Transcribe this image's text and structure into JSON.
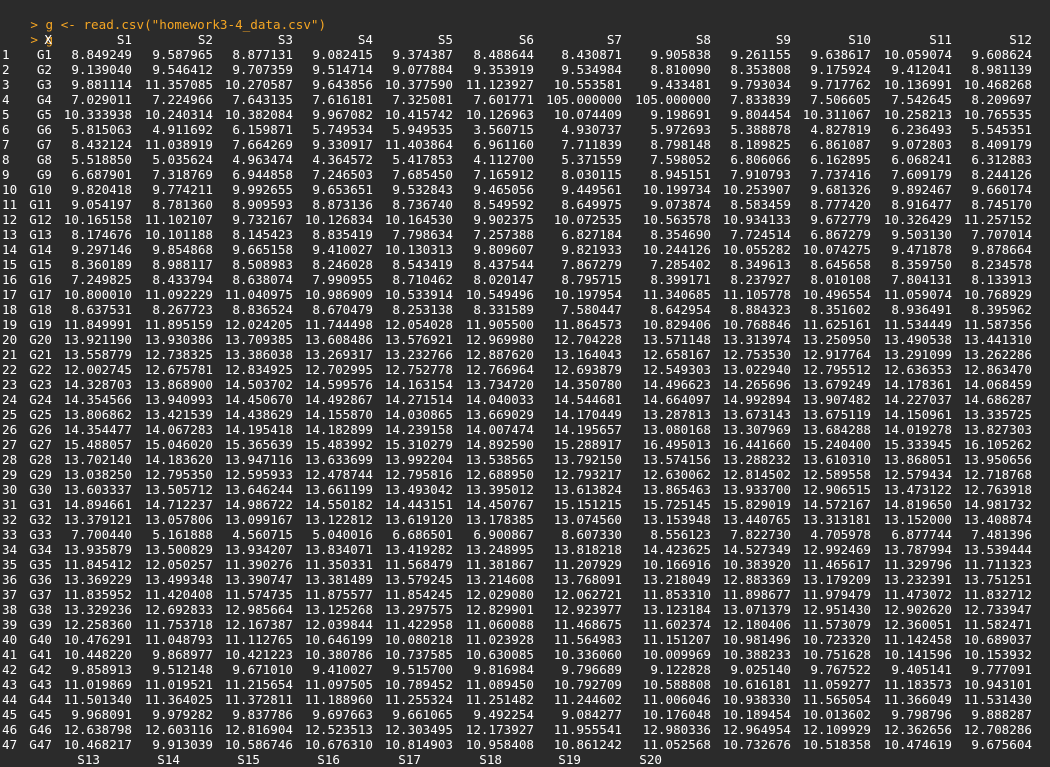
{
  "console": {
    "prompt": ">",
    "command": "g <- read.csv(\"homework3-4_data.csv\")",
    "command2": "g"
  },
  "table": {
    "columns": [
      "X",
      "S1",
      "S2",
      "S3",
      "S4",
      "S5",
      "S6",
      "S7",
      "S8",
      "S9",
      "S10",
      "S11",
      "S12"
    ],
    "rows": [
      [
        "1",
        "G1",
        "8.849249",
        "9.587965",
        "8.877131",
        "9.082415",
        "9.374387",
        "8.488644",
        "8.430871",
        "9.905838",
        "9.261155",
        "9.638617",
        "10.059074",
        "9.608624"
      ],
      [
        "2",
        "G2",
        "9.139040",
        "9.546412",
        "9.707359",
        "9.514714",
        "9.077884",
        "9.353919",
        "9.534984",
        "8.810090",
        "8.353808",
        "9.175924",
        "9.412041",
        "8.981139"
      ],
      [
        "3",
        "G3",
        "9.881114",
        "11.357085",
        "10.270587",
        "9.643856",
        "10.377590",
        "11.123927",
        "10.553581",
        "9.433481",
        "9.793034",
        "9.717762",
        "10.136991",
        "10.468268"
      ],
      [
        "4",
        "G4",
        "7.029011",
        "7.224966",
        "7.643135",
        "7.616181",
        "7.325081",
        "7.601771",
        "105.000000",
        "105.000000",
        "7.833839",
        "7.506605",
        "7.542645",
        "8.209697"
      ],
      [
        "5",
        "G5",
        "10.333938",
        "10.240314",
        "10.382084",
        "9.967082",
        "10.415742",
        "10.126963",
        "10.074409",
        "9.198691",
        "9.804454",
        "10.311067",
        "10.258213",
        "10.765535"
      ],
      [
        "6",
        "G6",
        "5.815063",
        "4.911692",
        "6.159871",
        "5.749534",
        "5.949535",
        "3.560715",
        "4.930737",
        "5.972693",
        "5.388878",
        "4.827819",
        "6.236493",
        "5.545351"
      ],
      [
        "7",
        "G7",
        "8.432124",
        "11.038919",
        "7.664269",
        "9.330917",
        "11.403864",
        "6.961160",
        "7.711839",
        "8.798148",
        "8.189825",
        "6.861087",
        "9.072803",
        "8.409179"
      ],
      [
        "8",
        "G8",
        "5.518850",
        "5.035624",
        "4.963474",
        "4.364572",
        "5.417853",
        "4.112700",
        "5.371559",
        "7.598052",
        "6.806066",
        "6.162895",
        "6.068241",
        "6.312883"
      ],
      [
        "9",
        "G9",
        "6.687901",
        "7.318769",
        "6.944858",
        "7.246503",
        "7.685450",
        "7.165912",
        "8.030115",
        "8.945151",
        "7.910793",
        "7.737416",
        "7.609179",
        "8.244126"
      ],
      [
        "10",
        "G10",
        "9.820418",
        "9.774211",
        "9.992655",
        "9.653651",
        "9.532843",
        "9.465056",
        "9.449561",
        "10.199734",
        "10.253907",
        "9.681326",
        "9.892467",
        "9.660174"
      ],
      [
        "11",
        "G11",
        "9.054197",
        "8.781360",
        "8.909593",
        "8.873136",
        "8.736740",
        "8.549592",
        "8.649975",
        "9.073874",
        "8.583459",
        "8.777420",
        "8.916477",
        "8.745170"
      ],
      [
        "12",
        "G12",
        "10.165158",
        "11.102107",
        "9.732167",
        "10.126834",
        "10.164530",
        "9.902375",
        "10.072535",
        "10.563578",
        "10.934133",
        "9.672779",
        "10.326429",
        "11.257152"
      ],
      [
        "13",
        "G13",
        "8.174676",
        "10.101188",
        "8.145423",
        "8.835419",
        "7.798634",
        "7.257388",
        "6.827184",
        "8.354690",
        "7.724514",
        "6.867279",
        "9.503130",
        "7.707014"
      ],
      [
        "14",
        "G14",
        "9.297146",
        "9.854868",
        "9.665158",
        "9.410027",
        "10.130313",
        "9.809607",
        "9.821933",
        "10.244126",
        "10.055282",
        "10.074275",
        "9.471878",
        "9.878664"
      ],
      [
        "15",
        "G15",
        "8.360189",
        "8.988117",
        "8.508983",
        "8.246028",
        "8.543419",
        "8.437544",
        "7.867279",
        "7.285402",
        "8.349613",
        "8.645658",
        "8.359750",
        "8.234578"
      ],
      [
        "16",
        "G16",
        "7.249825",
        "8.433794",
        "8.638074",
        "7.990955",
        "8.710462",
        "8.020147",
        "8.795715",
        "8.399171",
        "8.237927",
        "8.010108",
        "7.804131",
        "8.133913"
      ],
      [
        "17",
        "G17",
        "10.800010",
        "11.092229",
        "11.040975",
        "10.986909",
        "10.533914",
        "10.549496",
        "10.197954",
        "11.340685",
        "11.105778",
        "10.496554",
        "11.059074",
        "10.768929"
      ],
      [
        "18",
        "G18",
        "8.637531",
        "8.267723",
        "8.836524",
        "8.670479",
        "8.253138",
        "8.331589",
        "7.580447",
        "8.642954",
        "8.884323",
        "8.351602",
        "8.936491",
        "8.395962"
      ],
      [
        "19",
        "G19",
        "11.849991",
        "11.895159",
        "12.024205",
        "11.744498",
        "12.054028",
        "11.905500",
        "11.864573",
        "10.829406",
        "10.768846",
        "11.625161",
        "11.534449",
        "11.587356"
      ],
      [
        "20",
        "G20",
        "13.921190",
        "13.930386",
        "13.709385",
        "13.608486",
        "13.576921",
        "12.969980",
        "12.704228",
        "13.571148",
        "13.313974",
        "13.250950",
        "13.490538",
        "13.441310"
      ],
      [
        "21",
        "G21",
        "13.558779",
        "12.738325",
        "13.386038",
        "13.269317",
        "13.232766",
        "12.887620",
        "13.164043",
        "12.658167",
        "12.753530",
        "12.917764",
        "13.291099",
        "13.262286"
      ],
      [
        "22",
        "G22",
        "12.002745",
        "12.675781",
        "12.834925",
        "12.702995",
        "12.752778",
        "12.766964",
        "12.693879",
        "12.549303",
        "13.022940",
        "12.795512",
        "12.636353",
        "12.863470"
      ],
      [
        "23",
        "G23",
        "14.328703",
        "13.868900",
        "14.503702",
        "14.599576",
        "14.163154",
        "13.734720",
        "14.350780",
        "14.496623",
        "14.265696",
        "13.679249",
        "14.178361",
        "14.068459"
      ],
      [
        "24",
        "G24",
        "14.354566",
        "13.940993",
        "14.450670",
        "14.492867",
        "14.271514",
        "14.040033",
        "14.544681",
        "14.664097",
        "14.992894",
        "13.907482",
        "14.227037",
        "14.686287"
      ],
      [
        "25",
        "G25",
        "13.806862",
        "13.421539",
        "14.438629",
        "14.155870",
        "14.030865",
        "13.669029",
        "14.170449",
        "13.287813",
        "13.673143",
        "13.675119",
        "14.150961",
        "13.335725"
      ],
      [
        "26",
        "G26",
        "14.354477",
        "14.067283",
        "14.195418",
        "14.182899",
        "14.239158",
        "14.007474",
        "14.195657",
        "13.080168",
        "13.307969",
        "13.684288",
        "14.019278",
        "13.827303"
      ],
      [
        "27",
        "G27",
        "15.488057",
        "15.046020",
        "15.365639",
        "15.483992",
        "15.310279",
        "14.892590",
        "15.288917",
        "16.495013",
        "16.441660",
        "15.240400",
        "15.333945",
        "16.105262"
      ],
      [
        "28",
        "G28",
        "13.702140",
        "14.183620",
        "13.947116",
        "13.633699",
        "13.992204",
        "13.538565",
        "13.792150",
        "13.574156",
        "13.288232",
        "13.610310",
        "13.868051",
        "13.950656"
      ],
      [
        "29",
        "G29",
        "13.038250",
        "12.795350",
        "12.595933",
        "12.478744",
        "12.795816",
        "12.688950",
        "12.793217",
        "12.630062",
        "12.814502",
        "12.589558",
        "12.579434",
        "12.718768"
      ],
      [
        "30",
        "G30",
        "13.603337",
        "13.505712",
        "13.646244",
        "13.661199",
        "13.493042",
        "13.395012",
        "13.613824",
        "13.865463",
        "13.933700",
        "12.906515",
        "13.473122",
        "12.763918"
      ],
      [
        "31",
        "G31",
        "14.894661",
        "14.712237",
        "14.986722",
        "14.550182",
        "14.443151",
        "14.450767",
        "15.151215",
        "15.725145",
        "15.829019",
        "14.572167",
        "14.819650",
        "14.981732"
      ],
      [
        "32",
        "G32",
        "13.379121",
        "13.057806",
        "13.099167",
        "13.122812",
        "13.619120",
        "13.178385",
        "13.074560",
        "13.153948",
        "13.440765",
        "13.313181",
        "13.152000",
        "13.408874"
      ],
      [
        "33",
        "G33",
        "7.700440",
        "5.161888",
        "4.560715",
        "5.040016",
        "6.686501",
        "6.900867",
        "8.607330",
        "8.556123",
        "7.822730",
        "4.705978",
        "6.877744",
        "7.481396"
      ],
      [
        "34",
        "G34",
        "13.935879",
        "13.500829",
        "13.934207",
        "13.834071",
        "13.419282",
        "13.248995",
        "13.818218",
        "14.423625",
        "14.527349",
        "12.992469",
        "13.787994",
        "13.539444"
      ],
      [
        "35",
        "G35",
        "11.845412",
        "12.050257",
        "11.390276",
        "11.350331",
        "11.568479",
        "11.381867",
        "11.207929",
        "10.166916",
        "10.383920",
        "11.465617",
        "11.329796",
        "11.711323"
      ],
      [
        "36",
        "G36",
        "13.369229",
        "13.499348",
        "13.390747",
        "13.381489",
        "13.579245",
        "13.214608",
        "13.768091",
        "13.218049",
        "12.883369",
        "13.179209",
        "13.232391",
        "13.751251"
      ],
      [
        "37",
        "G37",
        "11.835952",
        "11.420408",
        "11.574735",
        "11.875577",
        "11.854245",
        "12.029080",
        "12.062721",
        "11.853310",
        "11.898677",
        "11.979479",
        "11.473072",
        "11.832712"
      ],
      [
        "38",
        "G38",
        "13.329236",
        "12.692833",
        "12.985664",
        "13.125268",
        "13.297575",
        "12.829901",
        "12.923977",
        "13.123184",
        "13.071379",
        "12.951430",
        "12.902620",
        "12.733947"
      ],
      [
        "39",
        "G39",
        "12.258360",
        "11.753718",
        "12.167387",
        "12.039844",
        "11.422958",
        "11.060088",
        "11.468675",
        "11.602374",
        "12.180406",
        "11.573079",
        "12.360051",
        "11.582471"
      ],
      [
        "40",
        "G40",
        "10.476291",
        "11.048793",
        "11.112765",
        "10.646199",
        "10.080218",
        "11.023928",
        "11.564983",
        "11.151207",
        "10.981496",
        "10.723320",
        "11.142458",
        "10.689037"
      ],
      [
        "41",
        "G41",
        "10.448220",
        "9.868977",
        "10.421223",
        "10.380786",
        "10.737585",
        "10.630085",
        "10.336060",
        "10.009969",
        "10.388233",
        "10.751628",
        "10.141596",
        "10.153932"
      ],
      [
        "42",
        "G42",
        "9.858913",
        "9.512148",
        "9.671010",
        "9.410027",
        "9.515700",
        "9.816984",
        "9.796689",
        "9.122828",
        "9.025140",
        "9.767522",
        "9.405141",
        "9.777091"
      ],
      [
        "43",
        "G43",
        "11.019869",
        "11.019521",
        "11.215654",
        "11.097505",
        "10.789452",
        "11.089450",
        "10.792709",
        "10.588808",
        "10.616181",
        "11.059277",
        "11.183573",
        "10.943101"
      ],
      [
        "44",
        "G44",
        "11.501340",
        "11.364025",
        "11.372811",
        "11.188960",
        "11.255324",
        "11.251482",
        "11.244602",
        "11.006046",
        "10.938330",
        "11.565054",
        "11.366049",
        "11.531430"
      ],
      [
        "45",
        "G45",
        "9.968091",
        "9.979282",
        "9.837786",
        "9.697663",
        "9.661065",
        "9.492254",
        "9.084277",
        "10.176048",
        "10.189454",
        "10.013602",
        "9.798796",
        "9.888287"
      ],
      [
        "46",
        "G46",
        "12.638798",
        "12.603116",
        "12.816904",
        "12.523513",
        "12.303495",
        "12.173927",
        "11.955541",
        "12.980336",
        "12.964954",
        "12.109929",
        "12.362656",
        "12.708286"
      ],
      [
        "47",
        "G47",
        "10.468217",
        "9.913039",
        "10.586746",
        "10.676310",
        "10.814903",
        "10.958408",
        "10.861242",
        "11.052568",
        "10.732676",
        "10.518358",
        "10.474619",
        "9.675604"
      ]
    ],
    "next_columns": [
      "S13",
      "S14",
      "S15",
      "S16",
      "S17",
      "S18",
      "S19",
      "S20"
    ]
  }
}
